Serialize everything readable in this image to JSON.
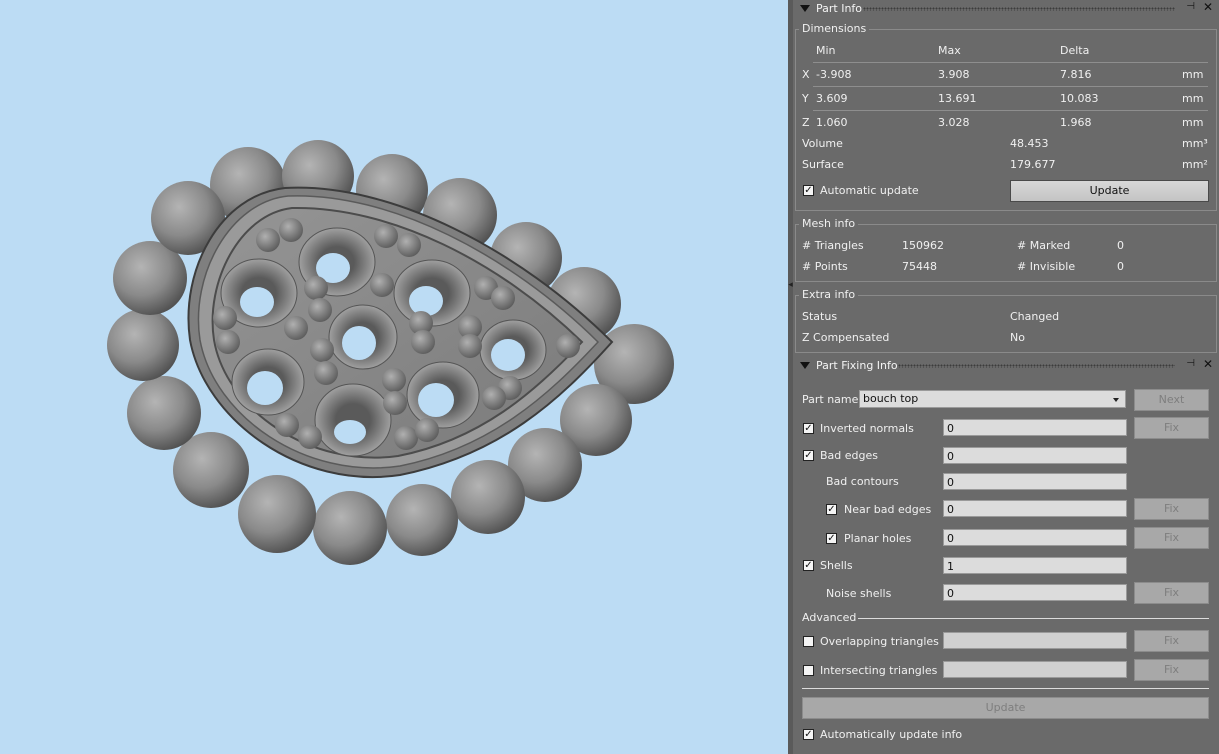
{
  "part_info": {
    "title": "Part Info",
    "dimensions": {
      "label": "Dimensions",
      "headers": [
        "Min",
        "Max",
        "Delta"
      ],
      "rows": [
        {
          "axis": "X",
          "min": "-3.908",
          "max": "3.908",
          "delta": "7.816",
          "unit": "mm"
        },
        {
          "axis": "Y",
          "min": "3.609",
          "max": "13.691",
          "delta": "10.083",
          "unit": "mm"
        },
        {
          "axis": "Z",
          "min": "1.060",
          "max": "3.028",
          "delta": "1.968",
          "unit": "mm"
        }
      ],
      "volume": {
        "label": "Volume",
        "value": "48.453",
        "unit": "mm³"
      },
      "surface": {
        "label": "Surface",
        "value": "179.677",
        "unit": "mm²"
      },
      "auto_update_label": "Automatic update",
      "auto_update_checked": true,
      "update_label": "Update"
    },
    "mesh_info": {
      "label": "Mesh info",
      "triangles_label": "# Triangles",
      "triangles": "150962",
      "points_label": "# Points",
      "points": "75448",
      "marked_label": "# Marked",
      "marked": "0",
      "invisible_label": "# Invisible",
      "invisible": "0"
    },
    "extra_info": {
      "label": "Extra info",
      "status_label": "Status",
      "status": "Changed",
      "z_comp_label": "Z Compensated",
      "z_comp": "No"
    }
  },
  "part_fixing": {
    "title": "Part Fixing Info",
    "part_name_label": "Part name",
    "part_name": "bouch top",
    "next_label": "Next",
    "fix_label": "Fix",
    "inverted_normals": {
      "label": "Inverted normals",
      "value": "0",
      "checked": true
    },
    "bad_edges": {
      "label": "Bad edges",
      "value": "0",
      "checked": true
    },
    "bad_contours": {
      "label": "Bad contours",
      "value": "0"
    },
    "near_bad_edges": {
      "label": "Near bad edges",
      "value": "0",
      "checked": true
    },
    "planar_holes": {
      "label": "Planar holes",
      "value": "0",
      "checked": true
    },
    "shells": {
      "label": "Shells",
      "value": "1",
      "checked": true
    },
    "noise_shells": {
      "label": "Noise shells",
      "value": "0"
    },
    "advanced_label": "Advanced",
    "overlapping": {
      "label": "Overlapping triangles",
      "value": "",
      "checked": false
    },
    "intersecting": {
      "label": "Intersecting triangles",
      "value": "",
      "checked": false
    },
    "update_label": "Update",
    "auto_update_info_label": "Automatically update info",
    "auto_update_info_checked": true
  },
  "colors": {
    "viewport_bg": "#bcdcf4",
    "panel_bg": "#6a6a6a",
    "model": "#8a8a8a"
  }
}
